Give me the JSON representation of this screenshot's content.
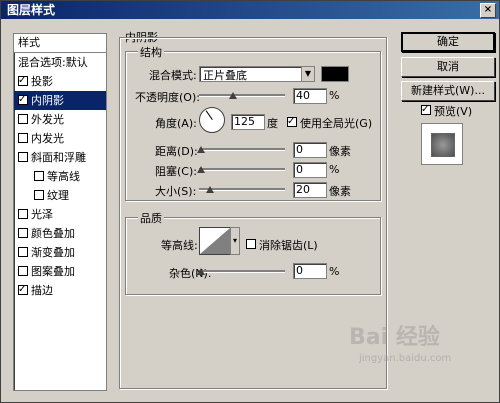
{
  "window": {
    "title": "图层样式",
    "close_icon": "×"
  },
  "styles_list": {
    "header": "样式",
    "items": [
      {
        "label": "混合选项:默认",
        "type": "plain",
        "checked": false,
        "selected": false
      },
      {
        "label": "投影",
        "type": "check",
        "checked": true,
        "selected": false
      },
      {
        "label": "内阴影",
        "type": "check",
        "checked": true,
        "selected": true
      },
      {
        "label": "外发光",
        "type": "check",
        "checked": false,
        "selected": false
      },
      {
        "label": "内发光",
        "type": "check",
        "checked": false,
        "selected": false
      },
      {
        "label": "斜面和浮雕",
        "type": "check",
        "checked": false,
        "selected": false
      },
      {
        "label": "等高线",
        "type": "sub",
        "checked": false,
        "selected": false
      },
      {
        "label": "纹理",
        "type": "sub",
        "checked": false,
        "selected": false
      },
      {
        "label": "光泽",
        "type": "check",
        "checked": false,
        "selected": false
      },
      {
        "label": "颜色叠加",
        "type": "check",
        "checked": false,
        "selected": false
      },
      {
        "label": "渐变叠加",
        "type": "check",
        "checked": false,
        "selected": false
      },
      {
        "label": "图案叠加",
        "type": "check",
        "checked": false,
        "selected": false
      },
      {
        "label": "描边",
        "type": "check",
        "checked": true,
        "selected": false
      }
    ]
  },
  "inner_shadow": {
    "title": "内阴影",
    "structure": {
      "title": "结构",
      "blend_mode_label": "混合模式:",
      "blend_mode_value": "正片叠底",
      "shadow_color": "#000000",
      "opacity_label": "不透明度(O):",
      "opacity_value": "40",
      "opacity_unit": "%",
      "angle_label": "角度(A):",
      "angle_value": "125",
      "angle_unit": "度",
      "global_light_label": "使用全局光(G)",
      "global_light_checked": true,
      "distance_label": "距离(D):",
      "distance_value": "0",
      "distance_unit": "像素",
      "choke_label": "阻塞(C):",
      "choke_value": "0",
      "choke_unit": "%",
      "size_label": "大小(S):",
      "size_value": "20",
      "size_unit": "像素"
    },
    "quality": {
      "title": "品质",
      "contour_label": "等高线:",
      "antialias_label": "消除锯齿(L)",
      "antialias_checked": false,
      "noise_label": "杂色(N):",
      "noise_value": "0",
      "noise_unit": "%"
    }
  },
  "buttons": {
    "ok": "确定",
    "cancel": "取消",
    "new_style": "新建样式(W)...",
    "preview_label": "预览(V)",
    "preview_checked": true
  },
  "watermark": {
    "brand": "Bai 经验",
    "url": "jingyan.baidu.com"
  }
}
